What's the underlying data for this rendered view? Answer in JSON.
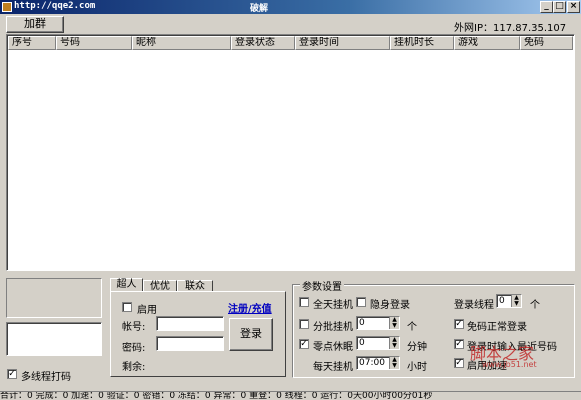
{
  "window": {
    "url": "http://qqe2.com",
    "title": "破解"
  },
  "toolbar": {
    "add_group_label": "加群",
    "ext_ip_label": "外网IP：117.87.35.107"
  },
  "table": {
    "columns": [
      "序号",
      "号码",
      "昵称",
      "登录状态",
      "登录时间",
      "挂机时长",
      "游戏",
      "免码"
    ]
  },
  "left_panel": {
    "multithread_label": "多线程打码",
    "multithread_checked": true
  },
  "login_panel": {
    "tabs": [
      "超人",
      "优优",
      "联众"
    ],
    "enable_label": "启用",
    "register_link": "注册/充值",
    "account_label": "帐号:",
    "password_label": "密码:",
    "remaining_label": "剩余:",
    "login_button": "登录"
  },
  "params": {
    "legend": "参数设置",
    "allday_label": "全天挂机",
    "stealth_label": "隐身登录",
    "batch_label": "分批挂机",
    "batch_value": "0",
    "batch_unit": "个",
    "zero_sleep_label": "零点休眠",
    "zero_sleep_value": "0",
    "zero_sleep_unit": "分钟",
    "daily_label": "每天挂机",
    "daily_value": "07:00",
    "daily_unit": "小时",
    "login_threads_label": "登录线程",
    "login_threads_value": "0",
    "login_threads_unit": "个",
    "free_code_label": "免码正常登录",
    "recent_label": "登录时输入最近号码",
    "accel_label": "启用加速",
    "zero_sleep_checked": true,
    "free_code_checked": true,
    "recent_checked": true,
    "accel_checked": true
  },
  "watermark": {
    "main": "脚本之家",
    "sub": "www.jb51.net"
  },
  "status_bar": "合计：0 完成：0 加速：0 验证：0 密错：0 冻结：0 异常：0 重登：0 线程：0 运行：0天00小时00分01秒"
}
